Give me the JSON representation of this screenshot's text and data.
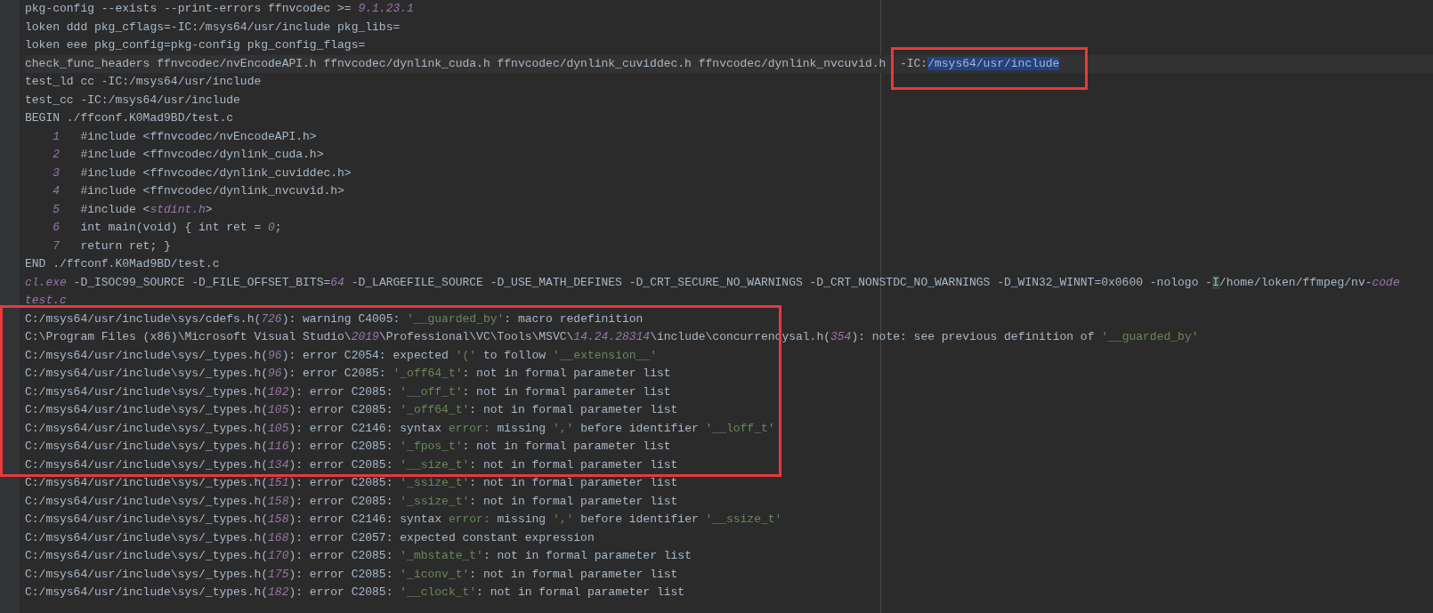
{
  "output": [
    {
      "kind": "line",
      "current": false,
      "segments": [
        {
          "kind": "text",
          "text": "pkg-config --exists --print-errors ffnvcodec >= "
        },
        {
          "kind": "number",
          "text": "9.1.23.1"
        }
      ]
    },
    {
      "kind": "line",
      "current": false,
      "segments": [
        {
          "kind": "text",
          "text": "loken ddd pkg_cflags=-IC:/msys64/usr/include pkg_libs="
        }
      ]
    },
    {
      "kind": "line",
      "current": false,
      "segments": [
        {
          "kind": "text",
          "text": "loken eee pkg_config=pkg-config pkg_config_flags="
        }
      ]
    },
    {
      "kind": "line",
      "current": true,
      "segments": [
        {
          "kind": "text",
          "text": "check_func_headers ffnvcodec/nvEncodeAPI.h ffnvcodec/dynlink_cuda.h ffnvcodec/dynlink_cuviddec.h ffnvcodec/dynlink_nvcuvid.h  "
        },
        {
          "kind": "annotated",
          "segments": [
            {
              "kind": "text",
              "text": "-IC:"
            },
            {
              "kind": "selected",
              "text": "/msys64/usr/include"
            }
          ]
        }
      ]
    },
    {
      "kind": "line",
      "current": false,
      "segments": [
        {
          "kind": "text",
          "text": "test_ld cc -IC:/msys64/usr/include"
        }
      ]
    },
    {
      "kind": "line",
      "current": false,
      "segments": [
        {
          "kind": "text",
          "text": "test_cc -IC:/msys64/usr/include"
        }
      ]
    },
    {
      "kind": "line",
      "current": false,
      "segments": [
        {
          "kind": "text",
          "text": "BEGIN ./ffconf.K0Mad9BD/test.c"
        }
      ]
    },
    {
      "kind": "line",
      "current": false,
      "segments": [
        {
          "kind": "line-number",
          "text": "1"
        },
        {
          "kind": "text",
          "text": "#include <ffnvcodec/nvEncodeAPI.h>"
        }
      ]
    },
    {
      "kind": "line",
      "current": false,
      "segments": [
        {
          "kind": "line-number",
          "text": "2"
        },
        {
          "kind": "text",
          "text": "#include <ffnvcodec/dynlink_cuda.h>"
        }
      ]
    },
    {
      "kind": "line",
      "current": false,
      "segments": [
        {
          "kind": "line-number",
          "text": "3"
        },
        {
          "kind": "text",
          "text": "#include <ffnvcodec/dynlink_cuviddec.h>"
        }
      ]
    },
    {
      "kind": "line",
      "current": false,
      "segments": [
        {
          "kind": "line-number",
          "text": "4"
        },
        {
          "kind": "text",
          "text": "#include <ffnvcodec/dynlink_nvcuvid.h>"
        }
      ]
    },
    {
      "kind": "line",
      "current": false,
      "segments": [
        {
          "kind": "line-number",
          "text": "5"
        },
        {
          "kind": "text",
          "text": "#include <"
        },
        {
          "kind": "number",
          "text": "stdint.h"
        },
        {
          "kind": "text",
          "text": ">"
        }
      ]
    },
    {
      "kind": "line",
      "current": false,
      "segments": [
        {
          "kind": "line-number",
          "text": "6"
        },
        {
          "kind": "text",
          "text": "int main(void) { int ret = "
        },
        {
          "kind": "number",
          "text": "0"
        },
        {
          "kind": "text",
          "text": ";"
        }
      ]
    },
    {
      "kind": "line",
      "current": false,
      "segments": [
        {
          "kind": "line-number",
          "text": "7"
        },
        {
          "kind": "text",
          "text": "return ret; }"
        }
      ]
    },
    {
      "kind": "line",
      "current": false,
      "segments": [
        {
          "kind": "text",
          "text": "END ./ffconf.K0Mad9BD/test.c"
        }
      ]
    },
    {
      "kind": "line",
      "current": false,
      "segments": [
        {
          "kind": "number",
          "text": "cl.exe"
        },
        {
          "kind": "text",
          "text": " -D_ISOC99_SOURCE -D_FILE_OFFSET_BITS="
        },
        {
          "kind": "number",
          "text": "64"
        },
        {
          "kind": "text",
          "text": " -D_LARGEFILE_SOURCE -D_USE_MATH_DEFINES -D_CRT_SECURE_NO_WARNINGS -D_CRT_NONSTDC_NO_WARNINGS -D_WIN32_WINNT=0x0600 -nologo -"
        },
        {
          "kind": "match",
          "text": "I"
        },
        {
          "kind": "text",
          "text": "/home/loken/ffmpeg/nv-"
        },
        {
          "kind": "number",
          "text": "code"
        }
      ]
    },
    {
      "kind": "line",
      "current": false,
      "segments": [
        {
          "kind": "number",
          "text": "test.c"
        }
      ]
    },
    {
      "kind": "annotation",
      "lines": [
        {
          "kind": "line",
          "current": false,
          "segments": [
            {
              "kind": "text",
              "text": "C:/msys64/usr/include\\sys/cdefs.h("
            },
            {
              "kind": "number",
              "text": "726"
            },
            {
              "kind": "text",
              "text": "): warning C4005: "
            },
            {
              "kind": "string",
              "text": "'__guarded_by'"
            },
            {
              "kind": "text",
              "text": ": macro redefinition"
            }
          ]
        },
        {
          "kind": "line",
          "current": false,
          "segments": [
            {
              "kind": "text",
              "text": "C:\\Program Files (x86)\\Microsoft Visual Studio\\"
            },
            {
              "kind": "number",
              "text": "2019"
            },
            {
              "kind": "text",
              "text": "\\Professional\\VC\\Tools\\MSVC\\"
            },
            {
              "kind": "number",
              "text": "14.24.28314"
            },
            {
              "kind": "text",
              "text": "\\include\\concurrencysal.h("
            },
            {
              "kind": "number",
              "text": "354"
            },
            {
              "kind": "text",
              "text": "): note: see previous definition of "
            },
            {
              "kind": "string",
              "text": "'__guarded_by'"
            }
          ]
        },
        {
          "kind": "line",
          "current": false,
          "segments": [
            {
              "kind": "text",
              "text": "C:/msys64/usr/include\\sys/_types.h("
            },
            {
              "kind": "number",
              "text": "96"
            },
            {
              "kind": "text",
              "text": "): error C2054: expected "
            },
            {
              "kind": "string",
              "text": "'('"
            },
            {
              "kind": "text",
              "text": " to follow "
            },
            {
              "kind": "string",
              "text": "'__extension__'"
            }
          ]
        },
        {
          "kind": "line",
          "current": false,
          "segments": [
            {
              "kind": "text",
              "text": "C:/msys64/usr/include\\sys/_types.h("
            },
            {
              "kind": "number",
              "text": "96"
            },
            {
              "kind": "text",
              "text": "): error C2085: "
            },
            {
              "kind": "string",
              "text": "'_off64_t'"
            },
            {
              "kind": "text",
              "text": ": not in formal parameter list"
            }
          ]
        },
        {
          "kind": "line",
          "current": false,
          "segments": [
            {
              "kind": "text",
              "text": "C:/msys64/usr/include\\sys/_types.h("
            },
            {
              "kind": "number",
              "text": "102"
            },
            {
              "kind": "text",
              "text": "): error C2085: "
            },
            {
              "kind": "string",
              "text": "'__off_t'"
            },
            {
              "kind": "text",
              "text": ": not in formal parameter list"
            }
          ]
        },
        {
          "kind": "line",
          "current": false,
          "segments": [
            {
              "kind": "text",
              "text": "C:/msys64/usr/include\\sys/_types.h("
            },
            {
              "kind": "number",
              "text": "105"
            },
            {
              "kind": "text",
              "text": "): error C2085: "
            },
            {
              "kind": "string",
              "text": "'_off64_t'"
            },
            {
              "kind": "text",
              "text": ": not in formal parameter list"
            }
          ]
        },
        {
          "kind": "line",
          "current": false,
          "segments": [
            {
              "kind": "text",
              "text": "C:/msys64/usr/include\\sys/_types.h("
            },
            {
              "kind": "number",
              "text": "105"
            },
            {
              "kind": "text",
              "text": "): error C2146: syntax "
            },
            {
              "kind": "string",
              "text": "error:"
            },
            {
              "kind": "text",
              "text": " missing "
            },
            {
              "kind": "string",
              "text": "','"
            },
            {
              "kind": "text",
              "text": " before identifier "
            },
            {
              "kind": "string",
              "text": "'__loff_t'"
            }
          ]
        },
        {
          "kind": "line",
          "current": false,
          "segments": [
            {
              "kind": "text",
              "text": "C:/msys64/usr/include\\sys/_types.h("
            },
            {
              "kind": "number",
              "text": "116"
            },
            {
              "kind": "text",
              "text": "): error C2085: "
            },
            {
              "kind": "string",
              "text": "'_fpos_t'"
            },
            {
              "kind": "text",
              "text": ": not in formal parameter list"
            }
          ]
        },
        {
          "kind": "line",
          "current": false,
          "segments": [
            {
              "kind": "text",
              "text": "C:/msys64/usr/include\\sys/_types.h("
            },
            {
              "kind": "number",
              "text": "134"
            },
            {
              "kind": "text",
              "text": "): error C2085: "
            },
            {
              "kind": "string",
              "text": "'__size_t'"
            },
            {
              "kind": "text",
              "text": ": not in formal parameter list"
            }
          ]
        }
      ]
    },
    {
      "kind": "line",
      "current": false,
      "segments": [
        {
          "kind": "text",
          "text": "C:/msys64/usr/include\\sys/_types.h("
        },
        {
          "kind": "number",
          "text": "151"
        },
        {
          "kind": "text",
          "text": "): error C2085: "
        },
        {
          "kind": "string",
          "text": "'_ssize_t'"
        },
        {
          "kind": "text",
          "text": ": not in formal parameter list"
        }
      ]
    },
    {
      "kind": "line",
      "current": false,
      "segments": [
        {
          "kind": "text",
          "text": "C:/msys64/usr/include\\sys/_types.h("
        },
        {
          "kind": "number",
          "text": "158"
        },
        {
          "kind": "text",
          "text": "): error C2085: "
        },
        {
          "kind": "string",
          "text": "'_ssize_t'"
        },
        {
          "kind": "text",
          "text": ": not in formal parameter list"
        }
      ]
    },
    {
      "kind": "line",
      "current": false,
      "segments": [
        {
          "kind": "text",
          "text": "C:/msys64/usr/include\\sys/_types.h("
        },
        {
          "kind": "number",
          "text": "158"
        },
        {
          "kind": "text",
          "text": "): error C2146: syntax "
        },
        {
          "kind": "string",
          "text": "error:"
        },
        {
          "kind": "text",
          "text": " missing "
        },
        {
          "kind": "string",
          "text": "','"
        },
        {
          "kind": "text",
          "text": " before identifier "
        },
        {
          "kind": "string",
          "text": "'__ssize_t'"
        }
      ]
    },
    {
      "kind": "line",
      "current": false,
      "segments": [
        {
          "kind": "text",
          "text": "C:/msys64/usr/include\\sys/_types.h("
        },
        {
          "kind": "number",
          "text": "168"
        },
        {
          "kind": "text",
          "text": "): error C2057: expected constant expression"
        }
      ]
    },
    {
      "kind": "line",
      "current": false,
      "segments": [
        {
          "kind": "text",
          "text": "C:/msys64/usr/include\\sys/_types.h("
        },
        {
          "kind": "number",
          "text": "170"
        },
        {
          "kind": "text",
          "text": "): error C2085: "
        },
        {
          "kind": "string",
          "text": "'_mbstate_t'"
        },
        {
          "kind": "text",
          "text": ": not in formal parameter list"
        }
      ]
    },
    {
      "kind": "line",
      "current": false,
      "segments": [
        {
          "kind": "text",
          "text": "C:/msys64/usr/include\\sys/_types.h("
        },
        {
          "kind": "number",
          "text": "175"
        },
        {
          "kind": "text",
          "text": "): error C2085: "
        },
        {
          "kind": "string",
          "text": "'_iconv_t'"
        },
        {
          "kind": "text",
          "text": ": not in formal parameter list"
        }
      ]
    },
    {
      "kind": "line",
      "current": false,
      "segments": [
        {
          "kind": "text",
          "text": "C:/msys64/usr/include\\sys/_types.h("
        },
        {
          "kind": "number",
          "text": "182"
        },
        {
          "kind": "text",
          "text": "): error C2085: "
        },
        {
          "kind": "string",
          "text": "'__clock_t'"
        },
        {
          "kind": "text",
          "text": ": not in formal parameter list"
        }
      ]
    }
  ]
}
